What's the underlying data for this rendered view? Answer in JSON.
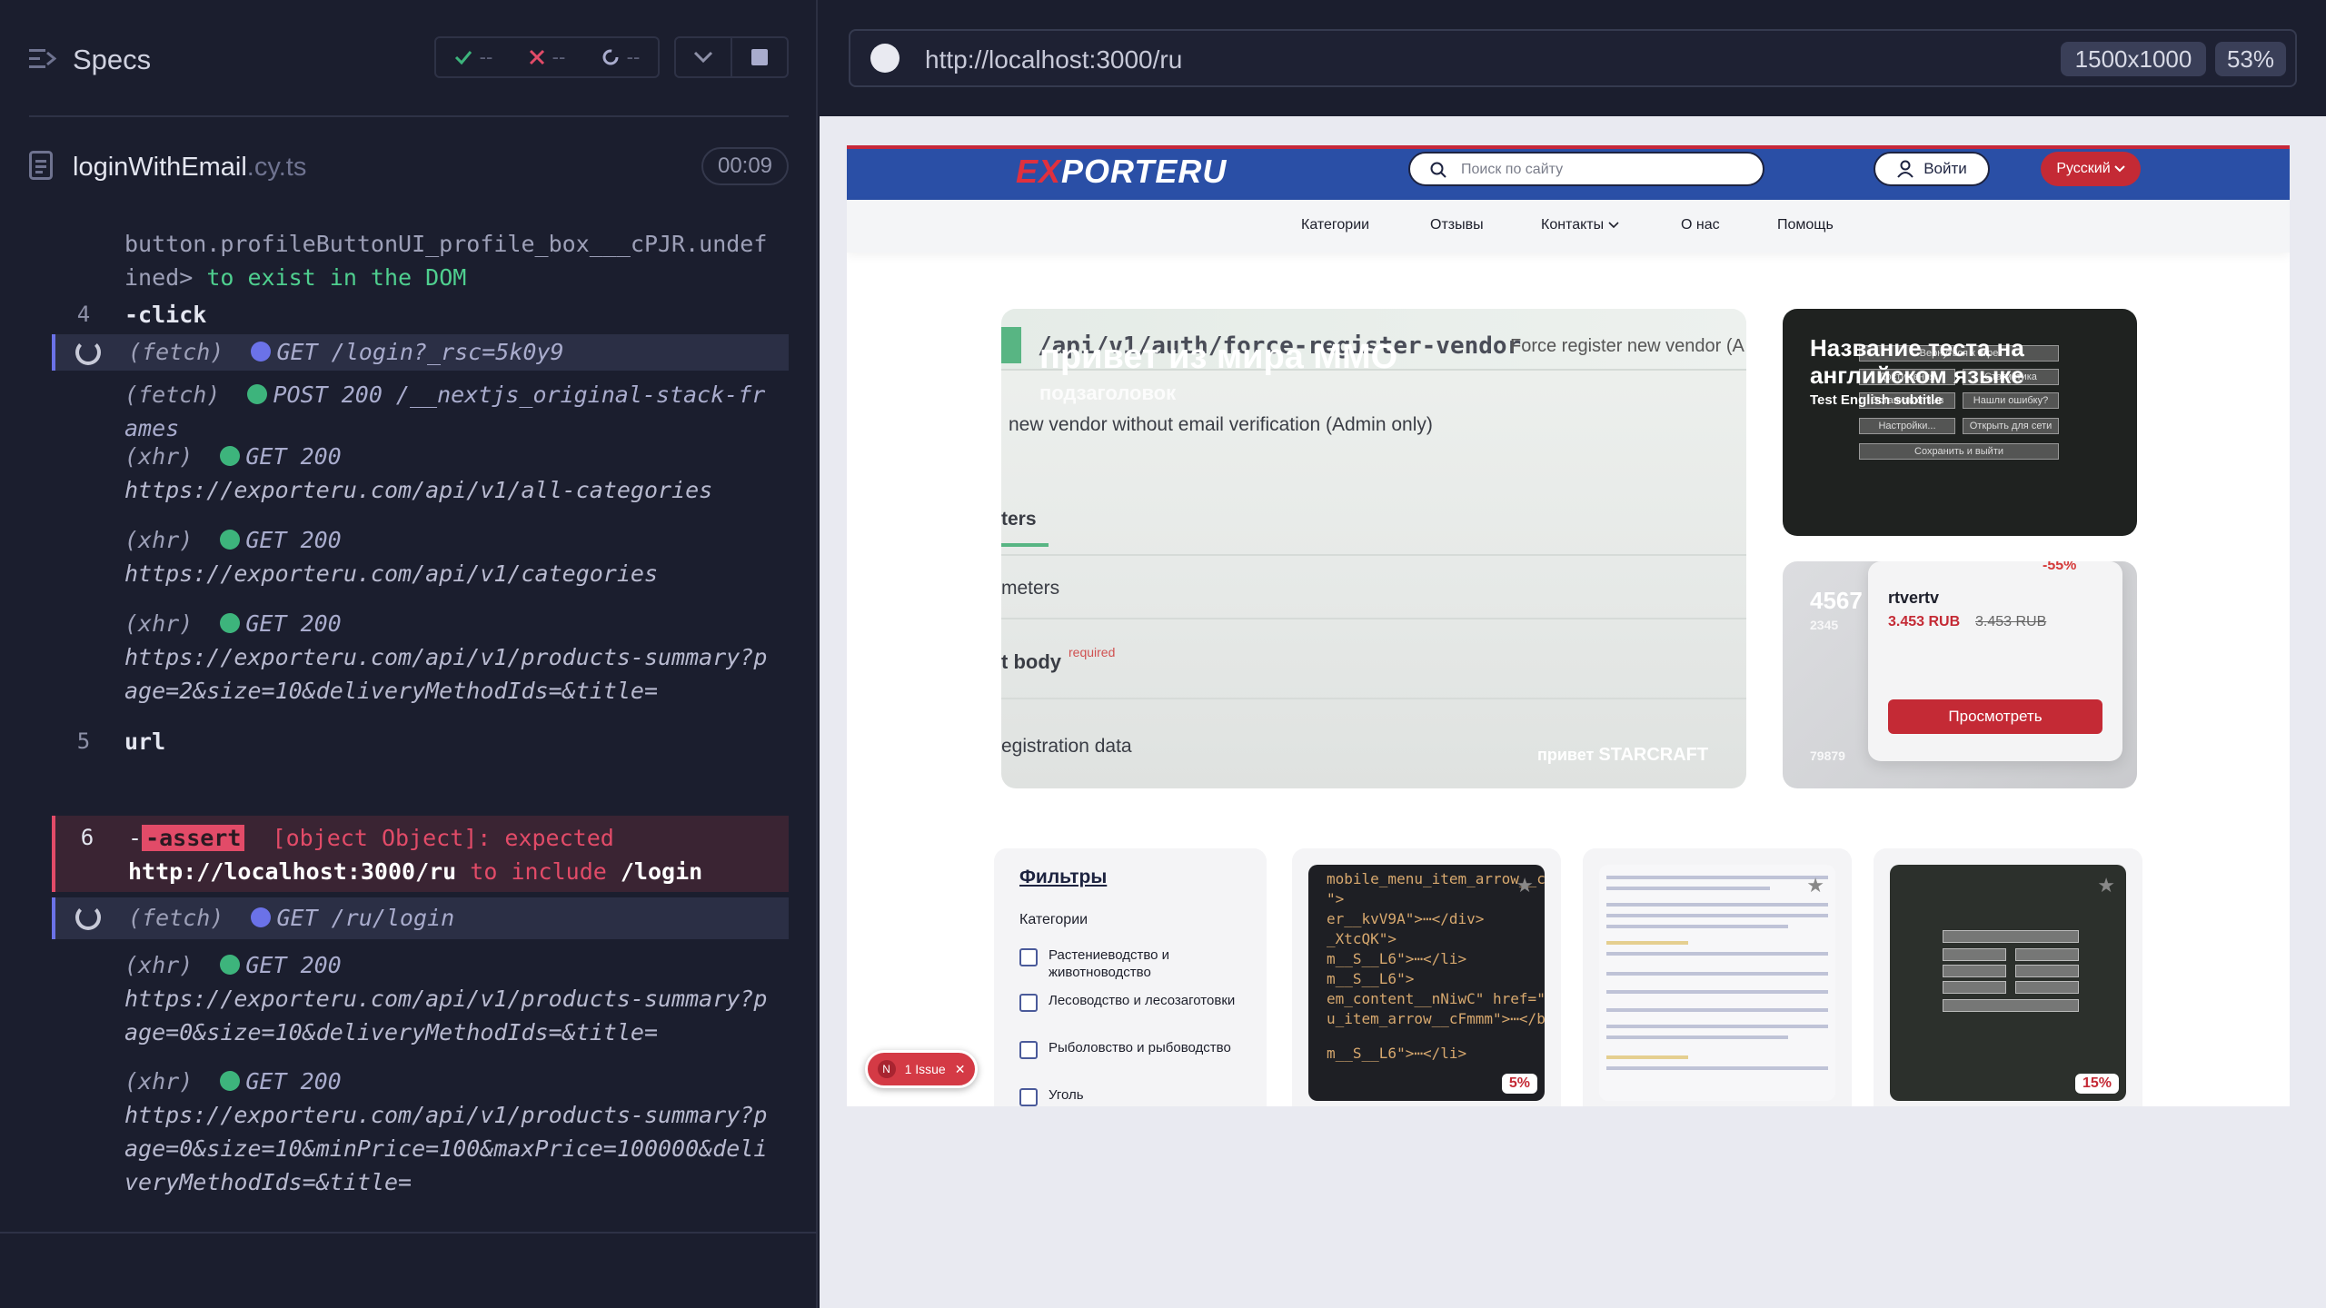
{
  "reporter": {
    "title": "Specs",
    "stats": {
      "passed": "--",
      "failed": "--",
      "pending": "--"
    },
    "file": {
      "name": "loginWithEmail",
      "ext": ".cy.ts",
      "duration": "00:09"
    },
    "commands": [
      {
        "id": "c0",
        "text": "button.profileButtonUI_profile_box___cPJR.undefined>",
        "suffix": " to exist in the DOM"
      },
      {
        "id": "c1",
        "num": "4",
        "text": "-click"
      },
      {
        "id": "c2",
        "type": "(fetch)",
        "method": "GET /login?_rsc=5k0y9",
        "status": "active"
      },
      {
        "id": "c3",
        "type": "(fetch)",
        "method": "POST 200 /__nextjs_original-stack-frames"
      },
      {
        "id": "c4",
        "type": "(xhr)",
        "method": "GET 200",
        "url": "https://exporteru.com/api/v1/all-categories"
      },
      {
        "id": "c5",
        "type": "(xhr)",
        "method": "GET 200",
        "url": "https://exporteru.com/api/v1/categories"
      },
      {
        "id": "c6",
        "type": "(xhr)",
        "method": "GET 200",
        "url": "https://exporteru.com/api/v1/products-summary?page=2&size=10&deliveryMethodIds=&title="
      },
      {
        "id": "c7",
        "num": "5",
        "text": "url"
      },
      {
        "id": "c8",
        "num": "6",
        "text": "-assert",
        "assert_text": "[object Object]: expected",
        "expected": "http://localhost:3000/ru",
        "to_include": "to include",
        "value": "/login",
        "status": "failed"
      },
      {
        "id": "c9",
        "type": "(fetch)",
        "method": "GET /ru/login",
        "status": "active"
      },
      {
        "id": "c10",
        "type": "(xhr)",
        "method": "GET 200",
        "url": "https://exporteru.com/api/v1/products-summary?page=0&size=10&deliveryMethodIds=&title="
      },
      {
        "id": "c11",
        "type": "(xhr)",
        "method": "GET 200",
        "url": "https://exporteru.com/api/v1/products-summary?page=0&size=10&minPrice=100&maxPrice=100000&deliveryMethodIds=&title="
      }
    ]
  },
  "aut": {
    "url": "http://localhost:3000/ru",
    "viewport": "1500x1000",
    "zoom": "53%"
  },
  "site": {
    "logo_ex": "EX",
    "logo_rest": "PORTERU",
    "search_placeholder": "Поиск по сайту",
    "login_label": "Войти",
    "lang_label": "Русский",
    "nav": [
      "Категории",
      "Отзывы",
      "Контакты",
      "О нас",
      "Помощь"
    ],
    "hero": {
      "title": "привет из мира ММО",
      "subtitle": "подзаголовок",
      "api_path": "/api/v1/auth/force-register-vendor",
      "api_desc": "Force register new vendor (A",
      "line1": "new vendor without email verification (Admin only)",
      "line2": "ters",
      "line3": "meters",
      "line4": "t body",
      "required": "required",
      "line5": "egistration data",
      "caption_prefix": "привет",
      "caption_bold": "STARCRAFT"
    },
    "card1": {
      "title": "Название теста на английском языке",
      "subtitle": "Test English subtitle",
      "menu": [
        "Вернуться к игре",
        "Достижения",
        "Статистика",
        "Оставить отзыв",
        "Нашли ошибку?",
        "Настройки...",
        "Открыть для сети",
        "Сохранить и выйти"
      ]
    },
    "card2": {
      "big": "4567",
      "small": "2345",
      "footer": "79879",
      "discount": "-55%",
      "name": "rtvertv",
      "price": "3.453 RUB",
      "old_price": "3.453 RUB",
      "button": "Просмотреть"
    },
    "filters": {
      "title": "Фильтры",
      "category_label": "Категории",
      "items": [
        "Растениеводство и животноводство",
        "Лесоводство и лесозаготовки",
        "Рыболовство и рыбоводство",
        "Уголь"
      ]
    },
    "products": [
      {
        "badge": "5%",
        "lines": [
          "mobile_menu_item_arrow__cFmm\">",
          "\">",
          "er__kvV9A\">⋯</div>",
          "_XtcQK\">",
          "m__S__L6\">⋯</li>",
          "m__S__L6\">",
          "em_content__nNiwC\" href=\"/categ",
          "u_item_arrow__cFmmm\">⋯</button",
          "m__S__L6\">⋯</li>"
        ]
      },
      {
        "badge": ""
      },
      {
        "badge": "15%"
      }
    ],
    "issue": {
      "count": "N",
      "label": "1 Issue"
    }
  }
}
